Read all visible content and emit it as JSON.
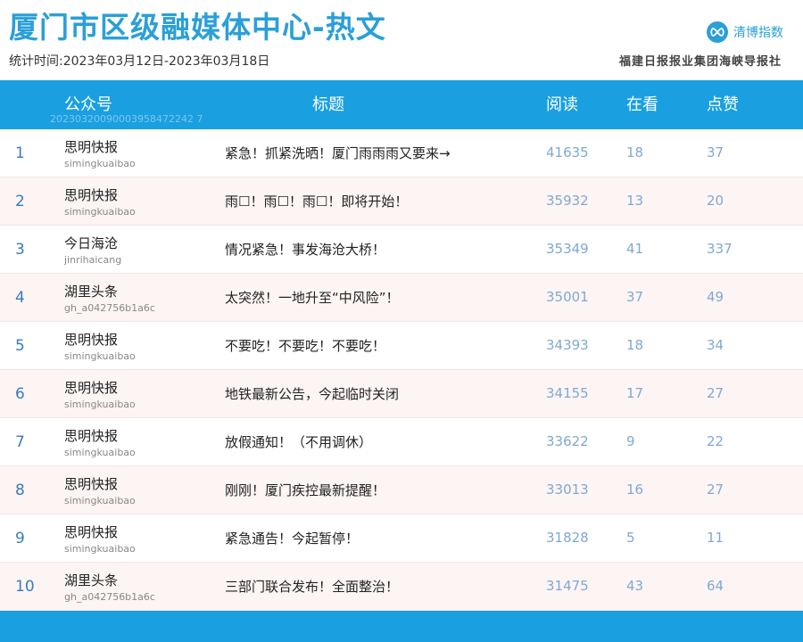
{
  "header": {
    "title": "厦门市区级融媒体中心-热文",
    "period": "统计时间:2023年03月12日-2023年03月18日",
    "brand": "清博指数",
    "brand_icon": "infinity-icon",
    "publisher": "福建日报报业集团海峡导报社"
  },
  "table": {
    "columns": {
      "account": "公众号",
      "title": "标题",
      "read": "阅读",
      "looking": "在看",
      "likes": "点赞"
    },
    "header_id": "20230320090003958472242 7",
    "rows": [
      {
        "rank": "1",
        "account": "思明快报",
        "account_id": "simingkuaibao",
        "title": "紧急！抓紧洗晒！厦门雨雨雨又要来→",
        "read": "41635",
        "looking": "18",
        "likes": "37"
      },
      {
        "rank": "2",
        "account": "思明快报",
        "account_id": "simingkuaibao",
        "title": "雨☐！雨☐！雨☐！即将开始！",
        "read": "35932",
        "looking": "13",
        "likes": "20"
      },
      {
        "rank": "3",
        "account": "今日海沧",
        "account_id": "jinrihaicang",
        "title": "情况紧急！事发海沧大桥！",
        "read": "35349",
        "looking": "41",
        "likes": "337"
      },
      {
        "rank": "4",
        "account": "湖里头条",
        "account_id": "gh_a042756b1a6c",
        "title": "太突然！一地升至“中风险”！",
        "read": "35001",
        "looking": "37",
        "likes": "49"
      },
      {
        "rank": "5",
        "account": "思明快报",
        "account_id": "simingkuaibao",
        "title": "不要吃！不要吃！不要吃！",
        "read": "34393",
        "looking": "18",
        "likes": "34"
      },
      {
        "rank": "6",
        "account": "思明快报",
        "account_id": "simingkuaibao",
        "title": "地铁最新公告，今起临时关闭",
        "read": "34155",
        "looking": "17",
        "likes": "27"
      },
      {
        "rank": "7",
        "account": "思明快报",
        "account_id": "simingkuaibao",
        "title": "放假通知！（不用调休）",
        "read": "33622",
        "looking": "9",
        "likes": "22"
      },
      {
        "rank": "8",
        "account": "思明快报",
        "account_id": "simingkuaibao",
        "title": "刚刚！厦门疾控最新提醒！",
        "read": "33013",
        "looking": "16",
        "likes": "27"
      },
      {
        "rank": "9",
        "account": "思明快报",
        "account_id": "simingkuaibao",
        "title": "紧急通告！今起暂停！",
        "read": "31828",
        "looking": "5",
        "likes": "11"
      },
      {
        "rank": "10",
        "account": "湖里头条",
        "account_id": "gh_a042756b1a6c",
        "title": "三部门联合发布！全面整治！",
        "read": "31475",
        "looking": "43",
        "likes": "64"
      }
    ]
  },
  "colors": {
    "accent": "#1aa0e0",
    "title": "#2a9fd8",
    "row_alt": "#fdf4f4",
    "numbers": "#7fa9d3"
  }
}
